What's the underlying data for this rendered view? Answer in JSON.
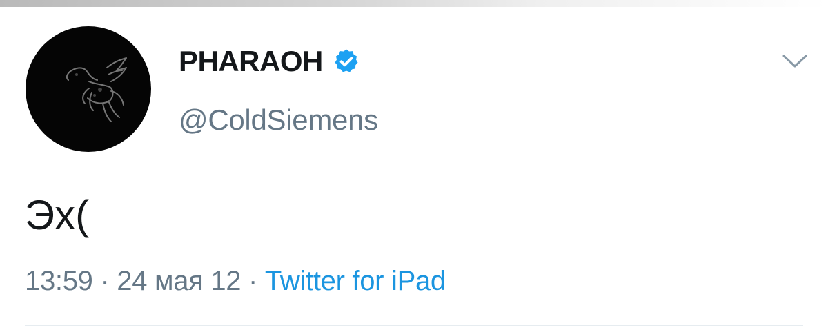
{
  "tweet": {
    "author": {
      "display_name": "PHARAOH",
      "handle": "@ColdSiemens",
      "verified": true,
      "avatar_icon": "pegasus-logo-icon"
    },
    "text": "Эх(",
    "meta": {
      "time": "13:59",
      "separator": "·",
      "date": "24 мая 12",
      "source": "Twitter for iPad"
    },
    "menu_icon": "chevron-down-icon"
  },
  "colors": {
    "background": "#ffffff",
    "text_primary": "#14171a",
    "text_secondary": "#657786",
    "link": "#1b95e0",
    "verified_badge": "#1da1f2",
    "avatar_bg": "#050505"
  }
}
